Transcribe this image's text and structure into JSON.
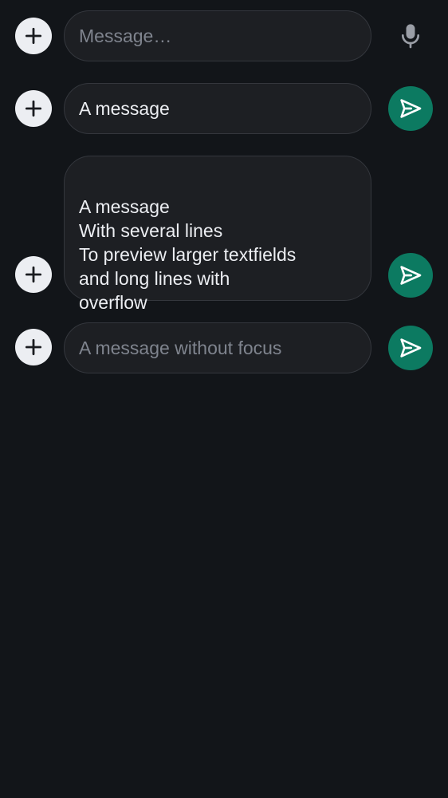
{
  "colors": {
    "background": "#121519",
    "field_background": "#1d1f23",
    "field_border": "#34373d",
    "text": "#eceef2",
    "placeholder": "#7f848e",
    "send_accent": "#0c7a61",
    "plus_button": "#eceef2"
  },
  "composers": [
    {
      "attach_icon": "plus-icon",
      "placeholder": "Message…",
      "value": "",
      "action_icon": "microphone-icon"
    },
    {
      "attach_icon": "plus-icon",
      "placeholder": "",
      "value": "A message",
      "action_icon": "send-icon"
    },
    {
      "attach_icon": "plus-icon",
      "placeholder": "",
      "value": "A message\nWith several lines\nTo preview larger textfields\nand long lines with\noverflow",
      "action_icon": "send-icon"
    },
    {
      "attach_icon": "plus-icon",
      "placeholder": "A message without focus",
      "value": "",
      "action_icon": "send-icon"
    }
  ]
}
